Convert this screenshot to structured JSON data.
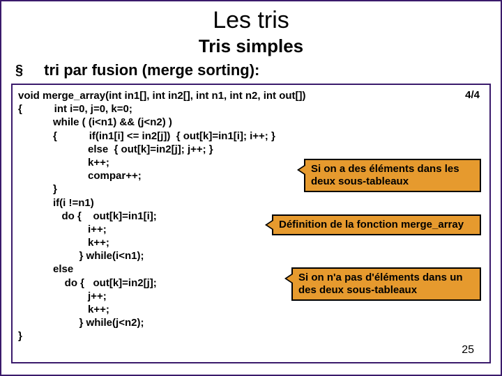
{
  "title": "Les tris",
  "subtitle": "Tris simples",
  "bullet_mark": "§",
  "bullet_text": "tri par fusion (merge sorting):",
  "page_counter": "4/4",
  "code": "void merge_array(int in1[], int in2[], int n1, int n2, int out[])\n{           int i=0, j=0, k=0;\n            while ( (i<n1) && (j<n2) )\n            {           if(in1[i] <= in2[j])  { out[k]=in1[i]; i++; }\n                        else  { out[k]=in2[j]; j++; }\n                        k++;\n                        compar++;\n            }\n            if(i !=n1)\n               do {    out[k]=in1[i];\n                        i++;\n                        k++;\n                     } while(i<n1);\n            else\n                do {   out[k]=in2[j];\n                        j++;\n                        k++;\n                     } while(j<n2);\n}",
  "callouts": {
    "c1": "Si on a des éléments dans les deux sous-tableaux",
    "c2": "Définition de la fonction merge_array",
    "c3": "Si on n'a pas d'éléments dans un des deux sous-tableaux"
  },
  "slide_number": "25"
}
